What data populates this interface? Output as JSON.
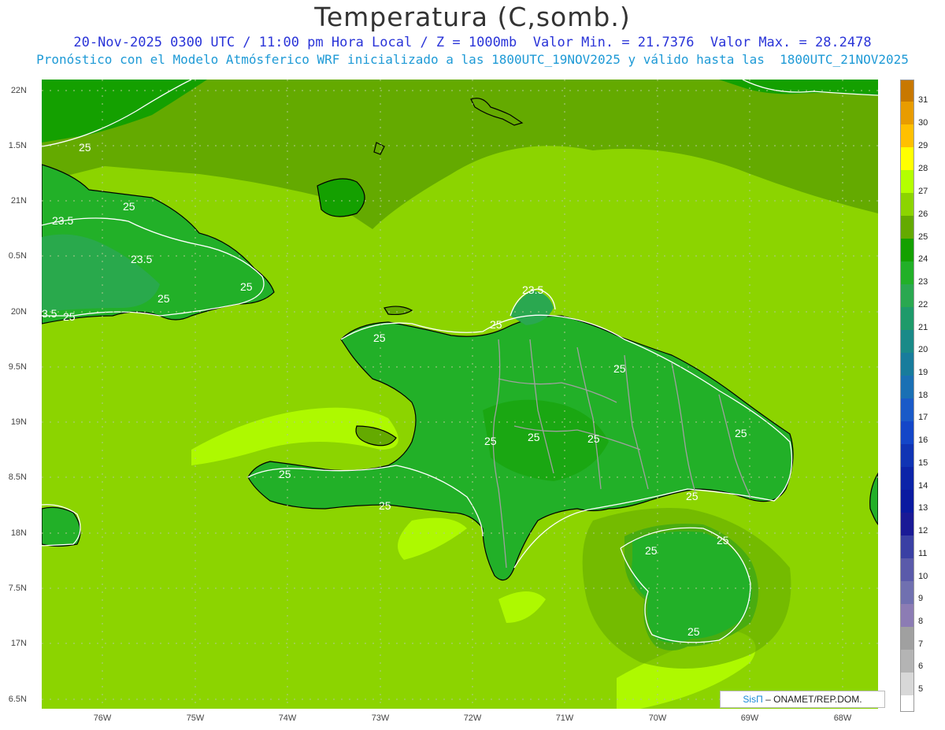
{
  "title": "Temperatura (C,somb.)",
  "subtitle_line1": "20-Nov-2025 0300 UTC / 11:00 pm Hora Local / Z = 1000mb  Valor Min. = 21.7376  Valor Max. = 28.2478",
  "subtitle_line2": "Pronóstico con el Modelo Atmósferico WRF inicializado a las 1800UTC_19NOV2025 y válido hasta las  1800UTC_21NOV2025",
  "lat_labels": [
    "22N",
    "1.5N",
    "21N",
    "0.5N",
    "20N",
    "9.5N",
    "19N",
    "8.5N",
    "18N",
    "7.5N",
    "17N",
    "6.5N"
  ],
  "lon_labels": [
    "76W",
    "75W",
    "74W",
    "73W",
    "72W",
    "71W",
    "70W",
    "69W",
    "68W"
  ],
  "contour_labels": [
    "25",
    "25",
    "23.5",
    "23.5",
    "25",
    "25",
    "3.5",
    "25",
    "23.5",
    "25",
    "25",
    "25",
    "25",
    "25",
    "25",
    "25",
    "25",
    "25",
    "25",
    "25",
    "25",
    "25",
    "25"
  ],
  "colorbar": {
    "labels": [
      "31",
      "30",
      "29",
      "28",
      "27",
      "26",
      "25",
      "24",
      "23",
      "22",
      "21",
      "20",
      "19",
      "18",
      "17",
      "16",
      "15",
      "14",
      "13",
      "12",
      "11",
      "10",
      "9",
      "8",
      "7",
      "6",
      "5"
    ],
    "colors": [
      "#c87800",
      "#e89c00",
      "#ffc000",
      "#ffff00",
      "#b4ff00",
      "#8cd400",
      "#64aa00",
      "#14a000",
      "#22b028",
      "#2aa850",
      "#1e9a6a",
      "#1a8a88",
      "#187c9c",
      "#1a70b4",
      "#1a5ac8",
      "#1446c8",
      "#1034b4",
      "#0c24a8",
      "#0a1aa0",
      "#1a1a96",
      "#3a40a4",
      "#5a5aaa",
      "#7070b0",
      "#8c7cb4",
      "#a0a0a0",
      "#b4b4b4",
      "#d8d8d8",
      "#ffffff"
    ]
  },
  "credit": {
    "brand": "SisΠ",
    "text": " –  ONAMET/REP.DOM."
  }
}
